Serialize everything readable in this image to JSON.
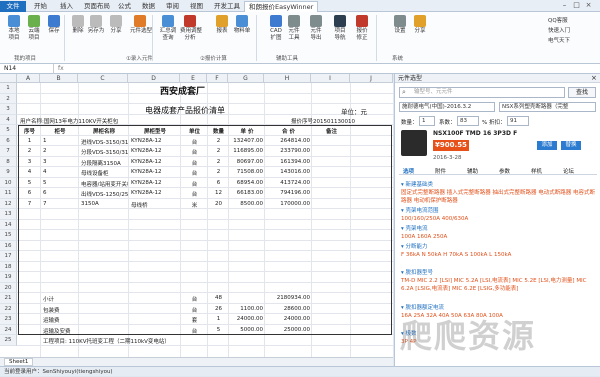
{
  "app": {
    "title": "和朗报价EasyWinner"
  },
  "tabs": [
    "文件",
    "开始",
    "插入",
    "页面布局",
    "公式",
    "数据",
    "审阅",
    "视图",
    "开发工具",
    "和朗报价EasyWinner"
  ],
  "ribbon": {
    "buttons": [
      {
        "label": "本地\n项目",
        "color": "#4a8fd6"
      },
      {
        "label": "云端\n项目",
        "color": "#6ab04c"
      },
      {
        "label": "保存",
        "color": "#3d7bd1"
      },
      {
        "label": "删除",
        "color": "#bbbbbb"
      },
      {
        "label": "另存为",
        "color": "#bbbbbb"
      },
      {
        "label": "分享",
        "color": "#bbbbbb"
      },
      {
        "label": "元件选型",
        "color": "#e07b2a"
      },
      {
        "label": "汇总调\n查询",
        "color": "#4a8fd6"
      },
      {
        "label": "费用调整\n分析",
        "color": "#c0392b"
      },
      {
        "label": "报表",
        "color": "#e0a02a"
      },
      {
        "label": "物料单",
        "color": "#4a8fd6"
      },
      {
        "label": "CAD\n扩图",
        "color": "#3d7bd1"
      },
      {
        "label": "元件\n工具",
        "color": "#7f8c8d"
      },
      {
        "label": "元件\n导出",
        "color": "#7f8c8d"
      },
      {
        "label": "项目\n导航",
        "color": "#2c3e50"
      },
      {
        "label": "报价\n修正",
        "color": "#c0392b"
      },
      {
        "label": "设置",
        "color": "#7f8c8d"
      },
      {
        "label": "分享",
        "color": "#e0a02a"
      }
    ],
    "groups": [
      "我的项目",
      "①录入元件",
      "②报价计算",
      "辅助工具",
      "系统"
    ],
    "side_links": [
      "QQ客服",
      "快速入门",
      "电气天下"
    ]
  },
  "formula_bar": {
    "name_box": "N14",
    "content": ""
  },
  "sheet": {
    "columns": [
      "A",
      "B",
      "C",
      "D",
      "E",
      "F",
      "G",
      "H",
      "I",
      "J"
    ],
    "title": "西安成套厂",
    "subtitle": "电器成套产品报价清单",
    "unit": "单位：元",
    "user_line": "用户名称:国网13年电力110KV开关柜包",
    "quote_no": "报价序号201501130010",
    "headers": [
      "序号",
      "柜号",
      "屏柜名称",
      "屏柜型号",
      "单位",
      "数量",
      "单 价",
      "合 价",
      "备注"
    ],
    "rows": [
      [
        "1",
        "1",
        "进线VDS-3150/31.5",
        "KYN28A-12",
        "台",
        "2",
        "132407.00",
        "264814.00",
        ""
      ],
      [
        "2",
        "2",
        "分段VDS-3150/31.5",
        "KYN28A-12",
        "台",
        "2",
        "116895.00",
        "233790.00",
        ""
      ],
      [
        "3",
        "3",
        "分段隔离3150A",
        "KYN28A-12",
        "台",
        "2",
        "80697.00",
        "161394.00",
        ""
      ],
      [
        "4",
        "4",
        "母线设备柜",
        "KYN28A-12",
        "台",
        "2",
        "71508.00",
        "143016.00",
        ""
      ],
      [
        "5",
        "5",
        "电容器/站用变开关柜VD-S",
        "KYN28A-12",
        "台",
        "6",
        "68954.00",
        "413724.00",
        ""
      ],
      [
        "6",
        "6",
        "出线VDS-1250/25",
        "KYN28A-12",
        "台",
        "12",
        "66183.00",
        "794196.00",
        ""
      ],
      [
        "7",
        "7",
        "3150A",
        "母线桥",
        "米",
        "20",
        "8500.00",
        "170000.00",
        ""
      ]
    ],
    "row_numbers": [
      "1",
      "2",
      "3",
      "4",
      "5",
      "6",
      "7",
      "8",
      "9",
      "10",
      "11",
      "12",
      "13",
      "14",
      "15",
      "16",
      "17",
      "18",
      "19",
      "20",
      "21",
      "22",
      "23",
      "24",
      "25"
    ],
    "summary": [
      {
        "row": "21",
        "label": "小计",
        "unit": "台",
        "qty": "48",
        "total": "2180934.00"
      },
      {
        "row": "22",
        "label": "包装费",
        "unit": "台",
        "qty": "26",
        "price": "1100.00",
        "total": "28600.00"
      },
      {
        "row": "23",
        "label": "运输费",
        "unit": "套",
        "qty": "1",
        "price": "24000.00",
        "total": "24000.00"
      },
      {
        "row": "24",
        "label": "运输及安费",
        "unit": "台",
        "qty": "5",
        "price": "5000.00",
        "total": "25000.00"
      }
    ],
    "footer_note": "工程项目: 110KV托班变工程（二期110kV变电站）",
    "sheet_tab": "Sheet1"
  },
  "status_bar": "当前登录用户：SenShiyouyi(tiengshiyou)",
  "panel": {
    "title": "元件选型",
    "search_placeholder": "输型号、元元件",
    "search_button": "查找",
    "brand_select": "施耐德电气(中国)-2016.3.2",
    "series_select": "NSX系列塑壳断路器（完整",
    "qty_label": "数量：",
    "qty_value": "1",
    "factor_label": "系数：",
    "factor_value": "83",
    "discount_label": "% 折扣：",
    "discount_value": "91",
    "product_name": "NSX100F TMD 16 3P3D F",
    "price": "¥900.55",
    "date": "2016-3-28",
    "add_label": "添加",
    "replace_label": "替换",
    "subtabs": [
      "选项",
      "附件",
      "辅助",
      "参数",
      "样机",
      "论坛"
    ],
    "categories": [
      {
        "title": "新建基础类",
        "items": "固定式完整断路器 插入式完整断路器 抽出式完整断路器 电动式断路器 电容式断路器 电动机保护断路器"
      },
      {
        "title": "壳架电流范围",
        "items": "100/160/250A 400/630A"
      },
      {
        "title": "壳架电流",
        "items": "100A 160A 250A"
      },
      {
        "title": "分断能力",
        "items": "F 36kA N 50kA H 70kA S 100kA L 150kA"
      },
      {
        "title": "脱扣器型号",
        "items": "TM-D MIC 2.2 [LSI] MIC 5.2A [LSI,电流表] MIC 5.2E [LSI,电力测量] MIC 6.2A [LSIG,电流表] MIC 6.2E [LSIG,多功能表]"
      },
      {
        "title": "脱扣器额定电流",
        "items": "16A 25A 32A 40A 50A 63A 80A 100A"
      },
      {
        "title": "极数",
        "items": "3P 4P"
      }
    ]
  },
  "watermark": "爬爬资源"
}
